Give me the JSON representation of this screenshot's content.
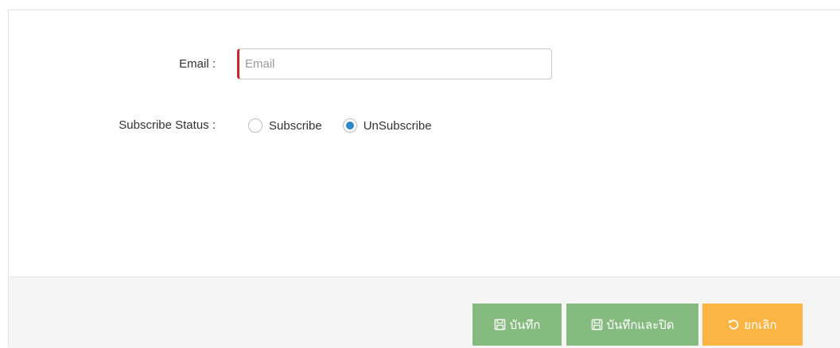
{
  "form": {
    "email_label": "Email :",
    "email_placeholder": "Email",
    "email_value": "",
    "status_label": "Subscribe Status :",
    "status_options": [
      {
        "label": "Subscribe",
        "checked": false
      },
      {
        "label": "UnSubscribe",
        "checked": true
      }
    ]
  },
  "footer": {
    "save_label": "บันทึก",
    "save_close_label": "บันทึกและปิด",
    "cancel_label": "ยกเลิก"
  },
  "colors": {
    "save": "#86bb80",
    "cancel": "#fbb545",
    "required": "#c9262b",
    "radio_checked": "#2d8ac6"
  },
  "icons": {
    "save": "floppy-disk-icon",
    "cancel": "undo-icon"
  }
}
